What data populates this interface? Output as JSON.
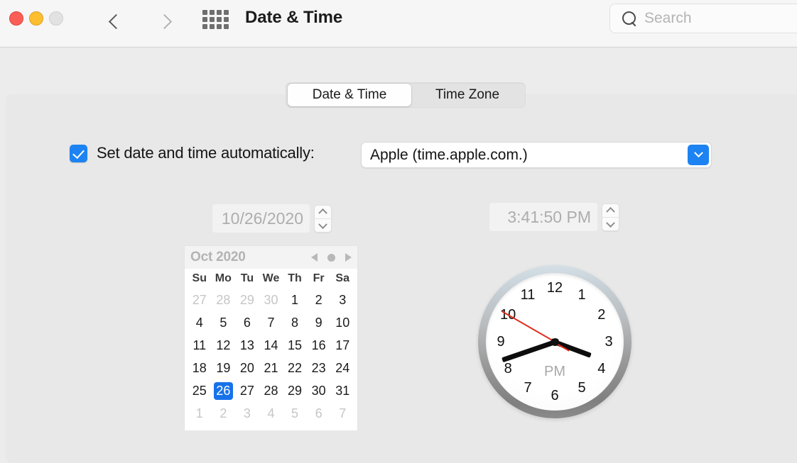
{
  "window": {
    "title": "Date & Time",
    "traffic_lights": [
      {
        "name": "close",
        "color": "#fa5f57"
      },
      {
        "name": "minimize",
        "color": "#fdbe2f"
      },
      {
        "name": "zoom",
        "color": "#e2e2e2"
      }
    ],
    "back_label": "Back",
    "forward_label": "Forward",
    "show_all_label": "Show All"
  },
  "search": {
    "placeholder": "Search",
    "value": ""
  },
  "tabs": [
    {
      "label": "Date & Time",
      "selected": true
    },
    {
      "label": "Time Zone",
      "selected": false
    }
  ],
  "auto_setting": {
    "checkbox_label": "Set date and time automatically:",
    "checked": true,
    "server_value": "Apple (time.apple.com.)"
  },
  "date_field": {
    "value": "10/26/2020",
    "enabled": false
  },
  "time_field": {
    "value": "3:41:50 PM",
    "enabled": false
  },
  "calendar": {
    "month_label": "Oct 2020",
    "weekdays": [
      "Su",
      "Mo",
      "Tu",
      "We",
      "Th",
      "Fr",
      "Sa"
    ],
    "selected_day": 26,
    "weeks": [
      [
        {
          "d": "27",
          "out": true
        },
        {
          "d": "28",
          "out": true
        },
        {
          "d": "29",
          "out": true
        },
        {
          "d": "30",
          "out": true
        },
        {
          "d": "1"
        },
        {
          "d": "2"
        },
        {
          "d": "3"
        }
      ],
      [
        {
          "d": "4"
        },
        {
          "d": "5"
        },
        {
          "d": "6"
        },
        {
          "d": "7"
        },
        {
          "d": "8"
        },
        {
          "d": "9"
        },
        {
          "d": "10"
        }
      ],
      [
        {
          "d": "11"
        },
        {
          "d": "12"
        },
        {
          "d": "13"
        },
        {
          "d": "14"
        },
        {
          "d": "15"
        },
        {
          "d": "16"
        },
        {
          "d": "17"
        }
      ],
      [
        {
          "d": "18"
        },
        {
          "d": "19"
        },
        {
          "d": "20"
        },
        {
          "d": "21"
        },
        {
          "d": "22"
        },
        {
          "d": "23"
        },
        {
          "d": "24"
        }
      ],
      [
        {
          "d": "25"
        },
        {
          "d": "26",
          "sel": true
        },
        {
          "d": "27"
        },
        {
          "d": "28"
        },
        {
          "d": "29"
        },
        {
          "d": "30"
        },
        {
          "d": "31"
        }
      ],
      [
        {
          "d": "1",
          "out": true
        },
        {
          "d": "2",
          "out": true
        },
        {
          "d": "3",
          "out": true
        },
        {
          "d": "4",
          "out": true
        },
        {
          "d": "5",
          "out": true
        },
        {
          "d": "6",
          "out": true
        },
        {
          "d": "7",
          "out": true
        }
      ]
    ]
  },
  "clock": {
    "hours": [
      "12",
      "1",
      "2",
      "3",
      "4",
      "5",
      "6",
      "7",
      "8",
      "9",
      "10",
      "11"
    ],
    "meridiem": "PM",
    "hour": 3,
    "minute": 41,
    "second": 50
  },
  "colors": {
    "accent_blue": "#1d83f2",
    "selection_blue": "#1772ea",
    "second_hand_red": "#e02b1d",
    "panel_bg": "#e8e8e8",
    "titlebar_bg": "#f6f6f6"
  }
}
